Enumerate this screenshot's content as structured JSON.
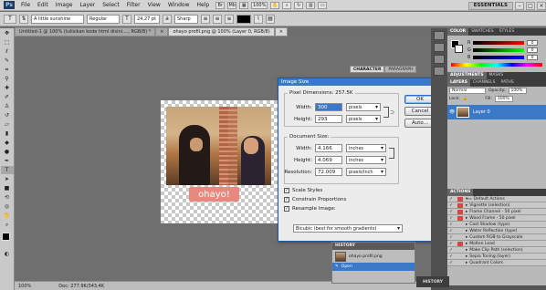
{
  "menubar": {
    "logo": "Ps",
    "items": [
      "File",
      "Edit",
      "Image",
      "Layer",
      "Select",
      "Filter",
      "View",
      "Window",
      "Help"
    ],
    "zoom": "100%",
    "workspace": "ESSENTIALS"
  },
  "options_bar": {
    "font_family": "A little sunshine",
    "font_style": "Regular",
    "font_size": "24,27 pt",
    "anti_alias": "Sharp"
  },
  "doc_tabs": [
    {
      "label": "Untitled-1 @ 100% (tulisikan kode html disini...., RGB/8) *"
    },
    {
      "label": "ohayo profil.png @ 100% (Layer 0, RGB/8)",
      "active": true
    }
  ],
  "status_bar": {
    "zoom": "100%",
    "doc": "Doc: 277.9K/343.4K"
  },
  "canvas": {
    "overlay_text": "ohayo!"
  },
  "dialog": {
    "title": "Image Size",
    "pixel_dimensions_legend": "Pixel Dimensions: 257.5K",
    "width_label": "Width:",
    "width_value": "300",
    "width_unit": "pixels",
    "height_label": "Height:",
    "height_value": "293",
    "height_unit": "pixels",
    "document_size_legend": "Document Size:",
    "doc_width_label": "Width:",
    "doc_width_value": "4.166",
    "doc_width_unit": "inches",
    "doc_height_label": "Height:",
    "doc_height_value": "4.069",
    "doc_height_unit": "inches",
    "resolution_label": "Resolution:",
    "resolution_value": "72.009",
    "resolution_unit": "pixels/inch",
    "scale_styles": "Scale Styles",
    "constrain": "Constrain Proportions",
    "resample": "Resample Image:",
    "resample_method": "Bicubic (best for smooth gradients)",
    "ok": "OK",
    "cancel": "Cancel",
    "auto": "Auto..."
  },
  "char_panel": {
    "tabs": [
      "CHARACTER",
      "PARAGRAPH"
    ]
  },
  "color_panel": {
    "tabs": [
      "COLOR",
      "SWATCHES",
      "STYLES"
    ],
    "r_label": "R",
    "g_label": "G",
    "b_label": "B",
    "r": "0",
    "g": "0",
    "b": "0"
  },
  "adjust_tabs": [
    "ADJUSTMENTS",
    "MASKS"
  ],
  "layers_panel": {
    "tabs": [
      "LAYERS",
      "CHANNELS",
      "PATHS"
    ],
    "mode": "Normal",
    "opacity_label": "Opacity:",
    "opacity": "100%",
    "lock_label": "Lock:",
    "fill_label": "Fill:",
    "fill": "100%",
    "layer_name": "Layer 0"
  },
  "actions_panel": {
    "tab": "ACTIONS",
    "items": [
      "Default Actions",
      "Vignette (selection)",
      "Frame Channel - 50 pixel",
      "Wood Frame - 50 pixel",
      "Cast Shadow (type)",
      "Water Reflection (type)",
      "Custom RGB to Grayscale",
      "Molten Lead",
      "Make Clip Path (selection)",
      "Sepia Toning (layer)",
      "Quadrant Colors"
    ]
  },
  "history_panel": {
    "title": "HISTORY",
    "items": [
      "ohayo profil.png",
      "Open"
    ]
  },
  "history_dock": "HISTORY",
  "colors": {
    "accent": "#3a79c8",
    "foreground_swatch": "#000000",
    "background_swatch": "#ffffff",
    "action_record": "#d34a45"
  }
}
